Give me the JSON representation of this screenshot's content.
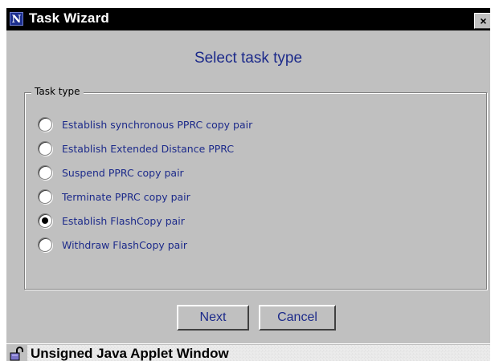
{
  "window": {
    "title": "Task Wizard",
    "app_icon_letter": "N",
    "close_glyph": "×"
  },
  "wizard": {
    "heading": "Select task type",
    "group_label": "Task type",
    "options": [
      {
        "label": "Establish synchronous PPRC copy pair",
        "selected": false
      },
      {
        "label": "Establish Extended Distance PPRC",
        "selected": false
      },
      {
        "label": "Suspend PPRC copy pair",
        "selected": false
      },
      {
        "label": "Terminate PPRC copy pair",
        "selected": false
      },
      {
        "label": "Establish FlashCopy pair",
        "selected": true
      },
      {
        "label": "Withdraw FlashCopy pair",
        "selected": false
      }
    ],
    "next_label": "Next",
    "cancel_label": "Cancel"
  },
  "statusbar": {
    "text": "Unsigned Java Applet Window",
    "icon": "unlocked-padlock-icon"
  },
  "colors": {
    "title_bar": "#000000",
    "window_bg": "#c0c0c0",
    "accent_text": "#1c2a8a"
  }
}
